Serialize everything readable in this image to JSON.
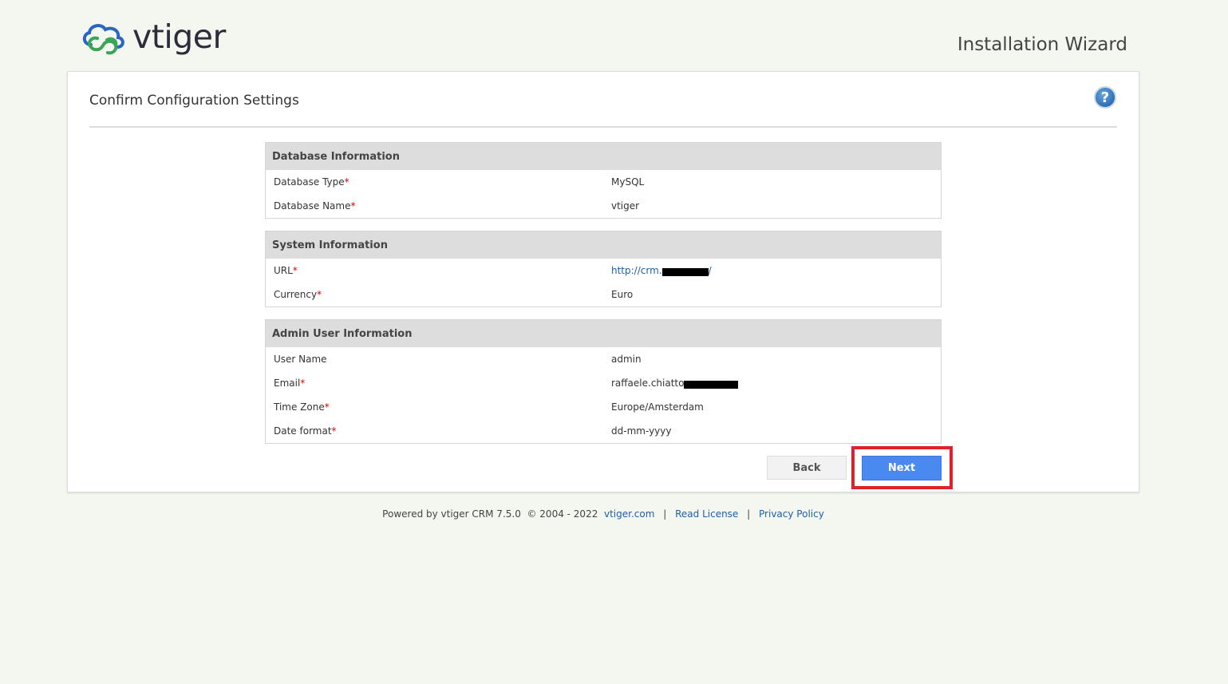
{
  "header": {
    "logo_text": "vtiger",
    "wizard_title": "Installation Wizard"
  },
  "panel": {
    "title": "Confirm Configuration Settings",
    "help_icon": "question-circle-icon"
  },
  "sections": [
    {
      "header": "Database Information",
      "rows": [
        {
          "label": "Database Type",
          "required": true,
          "value": "MySQL"
        },
        {
          "label": "Database Name",
          "required": true,
          "value": "vtiger"
        }
      ]
    },
    {
      "header": "System Information",
      "rows": [
        {
          "label": "URL",
          "required": true,
          "value": "http://crm.",
          "value_suffix": "/"
        },
        {
          "label": "Currency",
          "required": true,
          "value": "Euro"
        }
      ]
    },
    {
      "header": "Admin User Information",
      "rows": [
        {
          "label": "User Name",
          "required": false,
          "value": "admin"
        },
        {
          "label": "Email",
          "required": true,
          "value": "raffaele.chiatto"
        },
        {
          "label": "Time Zone",
          "required": true,
          "value": "Europe/Amsterdam"
        },
        {
          "label": "Date format",
          "required": true,
          "value": "dd-mm-yyyy"
        }
      ]
    }
  ],
  "required_marker": "*",
  "buttons": {
    "back": "Back",
    "next": "Next"
  },
  "footer": {
    "powered": "Powered by vtiger CRM 7.5.0",
    "copyright": "© 2004 - 2022",
    "links": [
      "vtiger.com",
      "Read License",
      "Privacy Policy"
    ],
    "separator": "|"
  },
  "colors": {
    "accent": "#4a8af0",
    "highlight": "#e0202a",
    "required": "#dd0000",
    "link": "#1f5fa8"
  }
}
